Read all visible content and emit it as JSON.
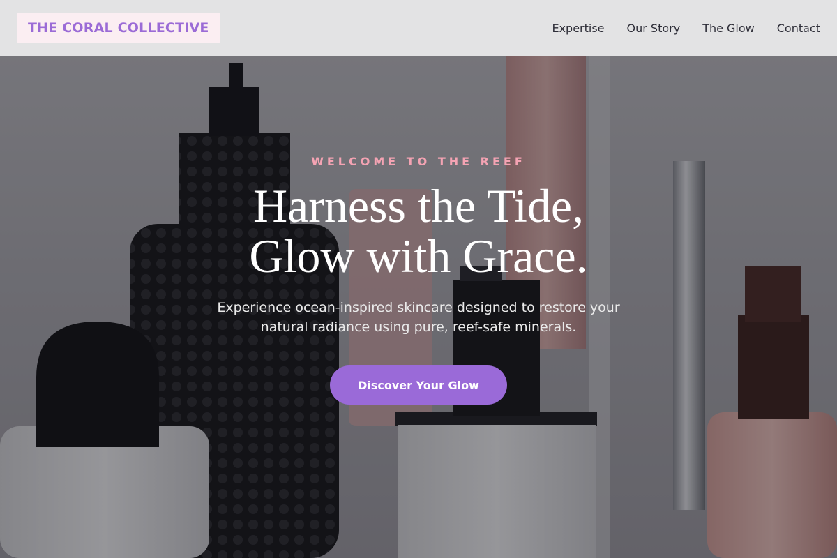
{
  "brand": {
    "logo_text": "THE CORAL COLLECTIVE"
  },
  "nav": {
    "items": [
      {
        "label": "Expertise"
      },
      {
        "label": "Our Story"
      },
      {
        "label": "The Glow"
      },
      {
        "label": "Contact"
      }
    ]
  },
  "hero": {
    "eyebrow": "WELCOME TO THE REEF",
    "headline_line1": "Harness the Tide,",
    "headline_line2": "Glow with Grace.",
    "subtext": "Experience ocean-inspired skincare designed to restore your natural radiance using pure, reef-safe minerals.",
    "cta_label": "Discover Your Glow",
    "background_image": "cosmetic-bottles-photo"
  },
  "colors": {
    "accent": "#9a6ad8",
    "eyebrow": "#f4a3b3",
    "logo_bg": "#fbeef2",
    "header_bg": "#e3e3e4"
  }
}
